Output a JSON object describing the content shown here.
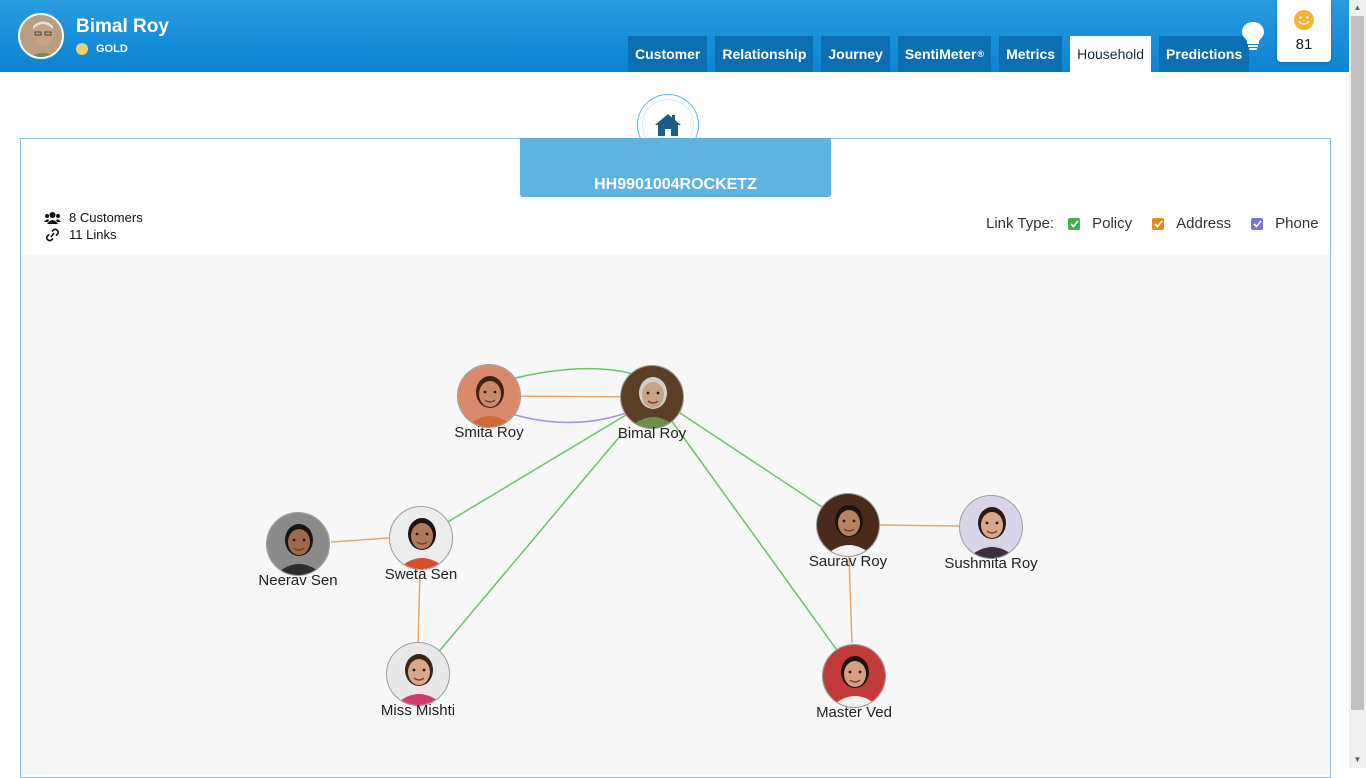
{
  "header": {
    "user_name": "Bimal Roy",
    "tier": "GOLD",
    "sentiment_score": "81",
    "tabs": [
      {
        "label": "Customer"
      },
      {
        "label": "Relationship"
      },
      {
        "label": "Journey"
      },
      {
        "label": "SentiMeter",
        "sup": "®"
      },
      {
        "label": "Metrics"
      },
      {
        "label": "Household",
        "active": true
      },
      {
        "label": "Predictions"
      }
    ]
  },
  "household": {
    "id": "HH9901004ROCKETZ",
    "customers": "8 Customers",
    "links": "11 Links",
    "link_type_label": "Link Type:",
    "link_types": [
      {
        "label": "Policy",
        "color": "#3fb24b"
      },
      {
        "label": "Address",
        "color": "#e8891c"
      },
      {
        "label": "Phone",
        "color": "#7a74cf"
      }
    ]
  },
  "graph": {
    "nodes": [
      {
        "name": "Smita Roy",
        "skin": "#c98a6a",
        "hair": "#3a2418",
        "shirt": "#cf6a3a",
        "bg": "#d98a6a"
      },
      {
        "name": "Bimal Roy",
        "skin": "#c9a386",
        "hair": "#cfcfcf",
        "shirt": "#6e8d4e",
        "bg": "#5a3e26"
      },
      {
        "name": "Neerav Sen",
        "skin": "#9c6a4a",
        "hair": "#1b1410",
        "shirt": "#2d2d2d",
        "bg": "#8a8a8a"
      },
      {
        "name": "Sweta Sen",
        "skin": "#b07a58",
        "hair": "#1e130d",
        "shirt": "#d84e2a",
        "bg": "#ececec"
      },
      {
        "name": "Miss Mishti",
        "skin": "#d9a88a",
        "hair": "#3a2418",
        "shirt": "#d13a6a",
        "bg": "#e8e8e8"
      },
      {
        "name": "Saurav Roy",
        "skin": "#b8835f",
        "hair": "#1b1410",
        "shirt": "#f1f1f1",
        "bg": "#4a2a1a"
      },
      {
        "name": "Sushmita Roy",
        "skin": "#d7a88c",
        "hair": "#2a1a12",
        "shirt": "#3a2e40",
        "bg": "#d9d4e8"
      },
      {
        "name": "Master Ved",
        "skin": "#d3a083",
        "hair": "#1b1410",
        "shirt": "#f2f2f2",
        "bg": "#c23a3a"
      }
    ]
  }
}
